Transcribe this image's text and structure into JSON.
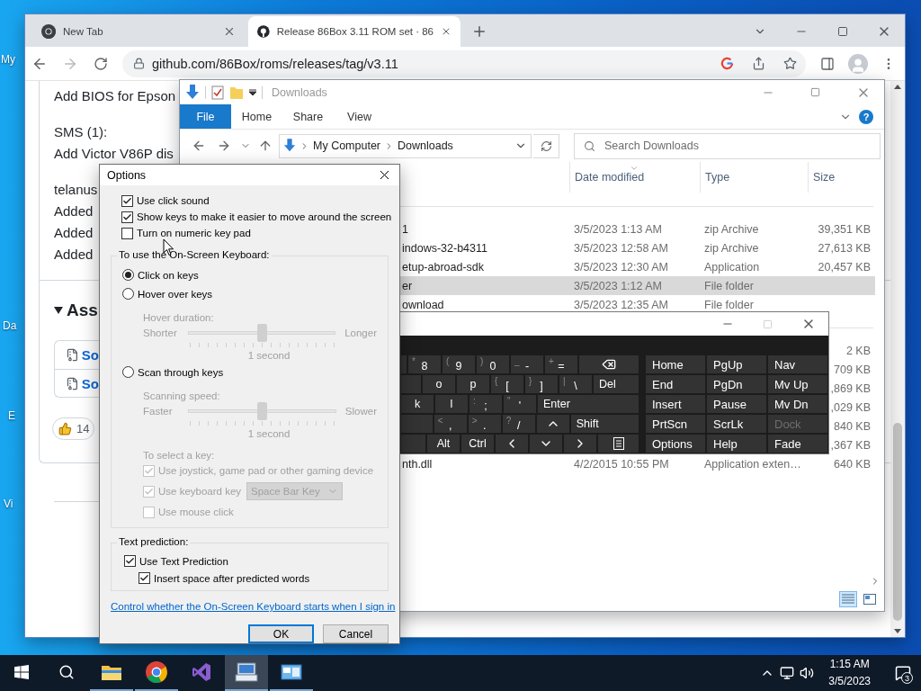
{
  "desktop": {
    "icon_labels": [
      "My",
      "Da",
      "E",
      "Vi"
    ]
  },
  "browser": {
    "tabs": [
      {
        "title": "New Tab",
        "selected": false
      },
      {
        "title": "Release 86Box 3.11 ROM set · 86",
        "selected": true
      }
    ],
    "url": "github.com/86Box/roms/releases/tag/v3.11",
    "paragraphs": [
      [
        "Add BIOS for Epson"
      ],
      [
        "SMS (1):",
        "Add Victor V86P dis"
      ],
      [
        "telanus",
        "Added",
        "Added",
        "Added"
      ]
    ],
    "assets_heading": "Ass",
    "assets": [
      "So",
      "So"
    ],
    "reaction_count": "14"
  },
  "explorer": {
    "title": "Downloads",
    "ribbon_tabs": [
      {
        "label": "File",
        "kind": "menu"
      },
      {
        "label": "Home",
        "kind": "tab"
      },
      {
        "label": "Share",
        "kind": "tab"
      },
      {
        "label": "View",
        "kind": "tab"
      }
    ],
    "help": "?",
    "breadcrumb": [
      "My Computer",
      "Downloads"
    ],
    "search_placeholder": "Search Downloads",
    "columns": [
      "Date modified",
      "Type",
      "Size"
    ],
    "groups": [
      {
        "rows": [
          {
            "name": "1",
            "date": "3/5/2023 1:13 AM",
            "type": "zip Archive",
            "size": "39,351 KB",
            "selected": false
          },
          {
            "name": "indows-32-b4311",
            "date": "3/5/2023 12:58 AM",
            "type": "zip Archive",
            "size": "27,613 KB",
            "selected": false
          },
          {
            "name": "etup-abroad-sdk",
            "date": "3/5/2023 12:30 AM",
            "type": "Application",
            "size": "20,457 KB",
            "selected": false
          },
          {
            "name": "er",
            "date": "3/5/2023 1:12 AM",
            "type": "File folder",
            "selected": true
          },
          {
            "name": "ownload",
            "date": "3/5/2023 12:35 AM",
            "type": "File folder",
            "selected": false
          }
        ]
      },
      {
        "rows": [
          {
            "size": "2 KB",
            "selected": false
          },
          {
            "size": "709 KB",
            "selected": false
          },
          {
            "size": ",869 KB",
            "selected": false
          },
          {
            "size": ",029 KB",
            "selected": false
          },
          {
            "size": "840 KB",
            "selected": false
          },
          {
            "size": ",367 KB",
            "selected": false
          },
          {
            "name": "nth.dll",
            "date": "4/2/2015 10:55 PM",
            "type": "Application exten…",
            "size": "640 KB",
            "selected": false
          }
        ]
      }
    ]
  },
  "osk": {
    "main_rows": [
      [
        {
          "kind": "blank"
        },
        {
          "kind": "char",
          "shift": "*",
          "label": "8"
        },
        {
          "kind": "char",
          "shift": "(",
          "label": "9"
        },
        {
          "kind": "char",
          "shift": ")",
          "label": "0"
        },
        {
          "kind": "char",
          "shift": "_",
          "label": "-"
        },
        {
          "kind": "char",
          "shift": "+",
          "label": "="
        },
        {
          "kind": "backspace"
        }
      ],
      [
        {
          "kind": "blank"
        },
        {
          "kind": "char",
          "label": "o"
        },
        {
          "kind": "char",
          "label": "p"
        },
        {
          "kind": "char",
          "shift": "{",
          "label": "["
        },
        {
          "kind": "char",
          "shift": "}",
          "label": "]"
        },
        {
          "kind": "char",
          "shift": "|",
          "label": "\\"
        },
        {
          "kind": "wide",
          "label": "Del"
        }
      ],
      [
        {
          "kind": "char",
          "label": "k"
        },
        {
          "kind": "char",
          "label": "l"
        },
        {
          "kind": "char",
          "shift": ":",
          "label": ";"
        },
        {
          "kind": "char",
          "shift": "\"",
          "label": "'"
        },
        {
          "kind": "wide",
          "label": "Enter"
        }
      ],
      [
        {
          "kind": "blank"
        },
        {
          "kind": "char",
          "shift": "<",
          "label": ","
        },
        {
          "kind": "char",
          "shift": ">",
          "label": "."
        },
        {
          "kind": "char",
          "shift": "?",
          "label": "/"
        },
        {
          "kind": "up"
        },
        {
          "kind": "wide",
          "label": "Shift"
        }
      ],
      [
        {
          "kind": "blank"
        },
        {
          "kind": "char",
          "label": "Alt"
        },
        {
          "kind": "char",
          "label": "Ctrl"
        },
        {
          "kind": "left"
        },
        {
          "kind": "down"
        },
        {
          "kind": "right"
        },
        {
          "kind": "menu"
        }
      ]
    ],
    "nav_rows": [
      [
        {
          "label": "Home",
          "disabled": false
        },
        {
          "label": "PgUp",
          "disabled": false
        },
        {
          "label": "Nav",
          "disabled": false
        }
      ],
      [
        {
          "label": "End",
          "disabled": false
        },
        {
          "label": "PgDn",
          "disabled": false
        },
        {
          "label": "Mv Up",
          "disabled": false
        }
      ],
      [
        {
          "label": "Insert",
          "disabled": false
        },
        {
          "label": "Pause",
          "disabled": false
        },
        {
          "label": "Mv Dn",
          "disabled": false
        }
      ],
      [
        {
          "label": "PrtScn",
          "disabled": false
        },
        {
          "label": "ScrLk",
          "disabled": false
        },
        {
          "label": "Dock",
          "disabled": true
        }
      ],
      [
        {
          "label": "Options",
          "disabled": false
        },
        {
          "label": "Help",
          "disabled": false
        },
        {
          "label": "Fade",
          "disabled": false
        }
      ]
    ]
  },
  "options": {
    "title": "Options",
    "top_checks": [
      {
        "label": "Use click sound",
        "checked": true
      },
      {
        "label": "Show keys to make it easier to move around the screen",
        "checked": true
      },
      {
        "label": "Turn on numeric key pad",
        "checked": false
      }
    ],
    "osk_group": {
      "legend": "To use the On-Screen Keyboard:",
      "items": [
        {
          "kind": "radio",
          "label": "Click on keys",
          "selected": true
        },
        {
          "kind": "radio",
          "label": "Hover over keys",
          "selected": false
        },
        {
          "kind": "caption",
          "label": "Hover duration:"
        },
        {
          "kind": "slider",
          "min_label": "Shorter",
          "max_label": "Longer",
          "level": 0.5,
          "reading": "1 second"
        },
        {
          "kind": "radio",
          "label": "Scan through keys",
          "selected": false
        },
        {
          "kind": "caption",
          "label": "Scanning speed:"
        },
        {
          "kind": "slider",
          "min_label": "Faster",
          "max_label": "Slower",
          "level": 0.5,
          "reading": "1 second"
        },
        {
          "kind": "caption",
          "label": "To select a key:"
        },
        {
          "kind": "checkbox",
          "label": "Use joystick, game pad or other gaming device",
          "checked": true
        },
        {
          "kind": "checkbox",
          "label": "Use keyboard key",
          "checked": true,
          "dropdown": "Space Bar Key"
        },
        {
          "kind": "checkbox",
          "label": "Use mouse click",
          "checked": false
        }
      ]
    },
    "prediction_group": {
      "legend": "Text prediction:",
      "items": [
        {
          "label": "Use Text Prediction",
          "checked": true,
          "children": [
            {
              "label": "Insert space after predicted words",
              "checked": true
            }
          ]
        }
      ]
    },
    "link": "Control whether the On-Screen Keyboard starts when I sign in",
    "buttons": [
      {
        "label": "OK",
        "default": true
      },
      {
        "label": "Cancel",
        "default": false
      }
    ]
  },
  "taskbar": {
    "apps": [
      {
        "kind": "explorer",
        "running": true,
        "selected": false
      },
      {
        "kind": "chrome",
        "running": true,
        "selected": false
      },
      {
        "kind": "studio",
        "running": false,
        "selected": false
      },
      {
        "kind": "osk",
        "running": true,
        "selected": true
      },
      {
        "kind": "control",
        "running": true,
        "selected": false
      }
    ],
    "time": "1:15 AM",
    "date": "3/5/2023",
    "notifications": "3"
  }
}
